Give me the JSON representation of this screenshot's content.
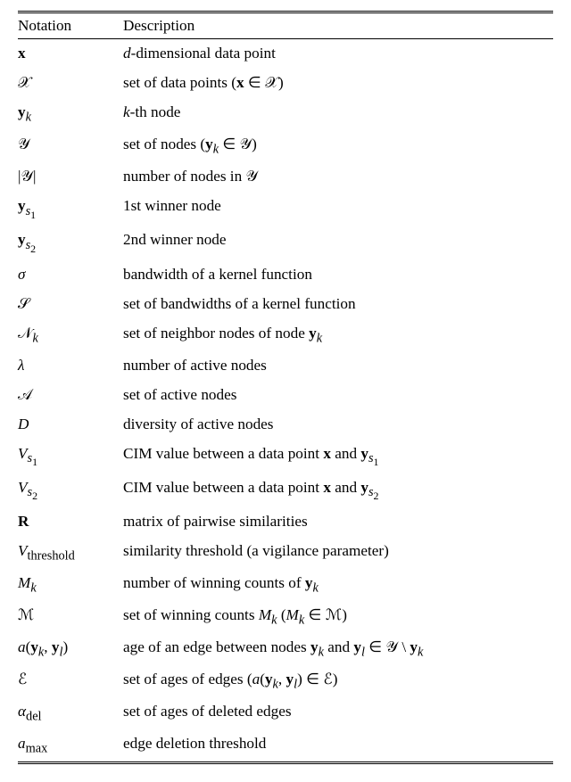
{
  "chart_data": {
    "type": "table",
    "title": "",
    "columns": [
      "Notation",
      "Description"
    ],
    "rows": [
      {
        "notation": "\\mathbf{x}",
        "description_parts": [
          {
            "t": "d",
            "i": true
          },
          {
            "t": "-dimensional data point"
          }
        ]
      },
      {
        "notation": "\\mathcal{X}",
        "description_parts": [
          {
            "t": "set of data points ("
          },
          {
            "m": "\\mathbf{x} \\in \\mathcal{X}"
          },
          {
            "t": ")"
          }
        ]
      },
      {
        "notation": "\\mathbf{y}_{k}",
        "description_parts": [
          {
            "t": "k",
            "i": true
          },
          {
            "t": "-th node"
          }
        ]
      },
      {
        "notation": "\\mathcal{Y}",
        "description_parts": [
          {
            "t": "set of nodes ("
          },
          {
            "m": "\\mathbf{y}_{k} \\in \\mathcal{Y}"
          },
          {
            "t": ")"
          }
        ]
      },
      {
        "notation": "|\\mathcal{Y}|",
        "description_parts": [
          {
            "t": "number of nodes in "
          },
          {
            "m": "\\mathcal{Y}"
          }
        ]
      },
      {
        "notation": "\\mathbf{y}_{s_{1}}",
        "description_parts": [
          {
            "t": "1st winner node"
          }
        ]
      },
      {
        "notation": "\\mathbf{y}_{s_{2}}",
        "description_parts": [
          {
            "t": "2nd winner node"
          }
        ]
      },
      {
        "notation": "\\sigma",
        "description_parts": [
          {
            "t": "bandwidth of a kernel function"
          }
        ]
      },
      {
        "notation": "\\mathcal{S}",
        "description_parts": [
          {
            "t": "set of bandwidths of a kernel function"
          }
        ]
      },
      {
        "notation": "\\mathcal{N}_{k}",
        "description_parts": [
          {
            "t": "set of neighbor nodes of node "
          },
          {
            "m": "\\mathbf{y}_{k}"
          }
        ]
      },
      {
        "notation": "\\lambda",
        "description_parts": [
          {
            "t": "number of active nodes"
          }
        ]
      },
      {
        "notation": "\\mathcal{A}",
        "description_parts": [
          {
            "t": "set of active nodes"
          }
        ]
      },
      {
        "notation": "D",
        "description_parts": [
          {
            "t": "diversity of active nodes"
          }
        ]
      },
      {
        "notation": "V_{s_{1}}",
        "description_parts": [
          {
            "t": "CIM value between a data point "
          },
          {
            "m": "\\mathbf{x}"
          },
          {
            "t": " and "
          },
          {
            "m": "\\mathbf{y}_{s_{1}}"
          }
        ]
      },
      {
        "notation": "V_{s_{2}}",
        "description_parts": [
          {
            "t": "CIM value between a data point "
          },
          {
            "m": "\\mathbf{x}"
          },
          {
            "t": " and "
          },
          {
            "m": "\\mathbf{y}_{s_{2}}"
          }
        ]
      },
      {
        "notation": "\\mathbf{R}",
        "description_parts": [
          {
            "t": "matrix of pairwise similarities"
          }
        ]
      },
      {
        "notation": "V_{\\text{threshold}}",
        "description_parts": [
          {
            "t": "similarity threshold (a vigilance parameter)"
          }
        ]
      },
      {
        "notation": "M_{k}",
        "description_parts": [
          {
            "t": "number of winning counts of "
          },
          {
            "m": "\\mathbf{y}_{k}"
          }
        ]
      },
      {
        "notation": "\\mathcal{M}",
        "description_parts": [
          {
            "t": "set of winning counts "
          },
          {
            "m": "M_{k}"
          },
          {
            "t": " ("
          },
          {
            "m": "M_{k} \\in \\mathcal{M}"
          },
          {
            "t": ")"
          }
        ]
      },
      {
        "notation": "a(\\mathbf{y}_{k}, \\mathbf{y}_{l})",
        "description_parts": [
          {
            "t": "age of an edge between nodes "
          },
          {
            "m": "\\mathbf{y}_{k}"
          },
          {
            "t": " and "
          },
          {
            "m": "\\mathbf{y}_{l} \\in \\mathcal{Y} \\setminus \\mathbf{y}_{k}"
          }
        ]
      },
      {
        "notation": "\\mathcal{E}",
        "description_parts": [
          {
            "t": "set of ages of edges ("
          },
          {
            "m": "a(\\mathbf{y}_{k}, \\mathbf{y}_{l}) \\in \\mathcal{E}"
          },
          {
            "t": ")"
          }
        ]
      },
      {
        "notation": "\\alpha_{\\text{del}}",
        "description_parts": [
          {
            "t": "set of ages of deleted edges"
          }
        ]
      },
      {
        "notation": "a_{\\text{max}}",
        "description_parts": [
          {
            "t": "edge deletion threshold"
          }
        ]
      }
    ]
  },
  "headers": {
    "notation": "Notation",
    "description": "Description"
  }
}
